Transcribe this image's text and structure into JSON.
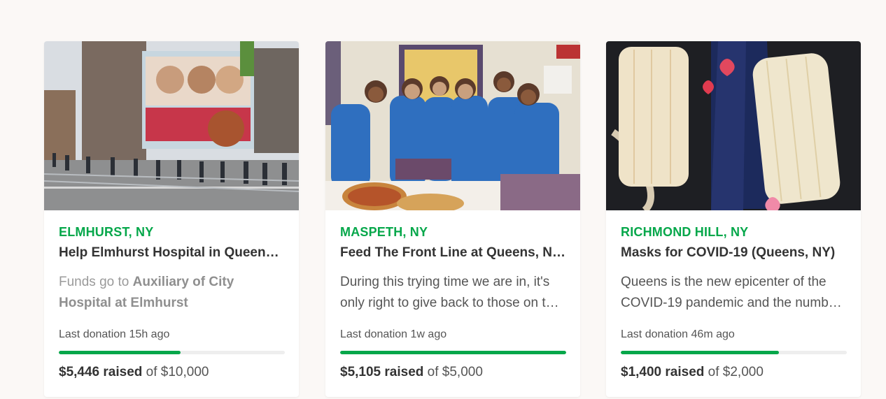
{
  "cards": [
    {
      "location": "ELMHURST, NY",
      "title": "Help Elmhurst Hospital in Queens, NY",
      "desc_prefix": "Funds go to ",
      "desc_bold": "Auxiliary of City Hospital at Elmhurst",
      "last_donation": "Last donation 15h ago",
      "progress_fraction": 0.54,
      "raised": "$5,446 raised",
      "goal": "of $10,000",
      "image_icon": "hospital-photo"
    },
    {
      "location": "MASPETH, NY",
      "title": "Feed The Front Line at Queens, NY Hospital",
      "description": "During this trying time we are in, it's only right to give back to those on the front lines.",
      "last_donation": "Last donation 1w ago",
      "progress_fraction": 1.0,
      "raised": "$5,105 raised",
      "goal": "of $5,000",
      "image_icon": "nurses-photo"
    },
    {
      "location": "RICHMOND HILL, NY",
      "title": "Masks for COVID-19 (Queens, NY)",
      "description": "Queens is the new epicenter of the COVID-19 pandemic and the number of cases keeps growing.",
      "last_donation": "Last donation 46m ago",
      "progress_fraction": 0.7,
      "raised": "$1,400 raised",
      "goal": "of $2,000",
      "image_icon": "masks-photo"
    }
  ],
  "colors": {
    "accent": "#05a74a",
    "page_background": "#fbf8f6",
    "card_background": "#ffffff",
    "track": "#eeeeee"
  }
}
